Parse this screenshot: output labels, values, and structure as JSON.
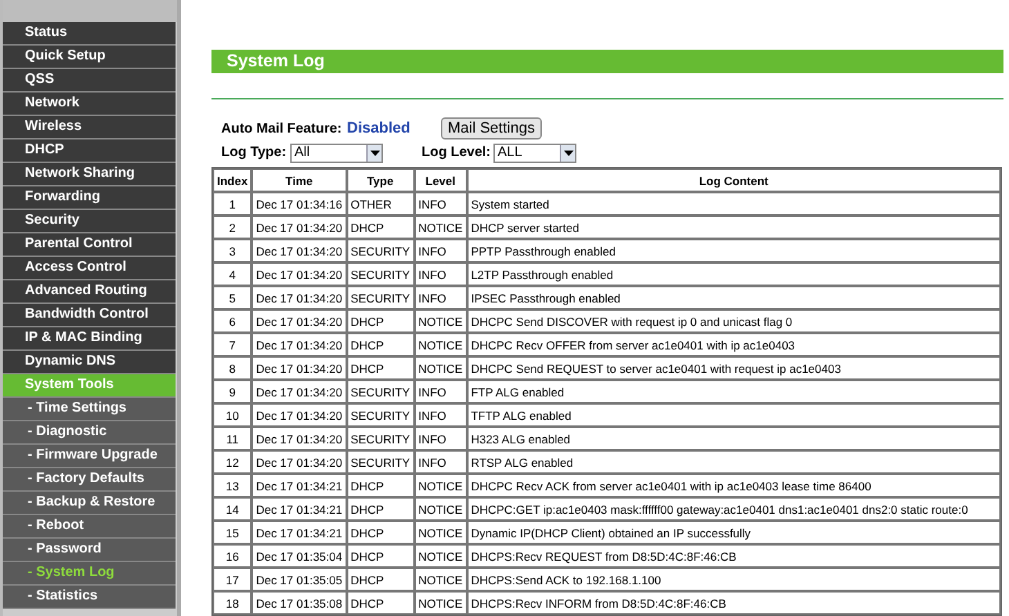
{
  "sidebar": {
    "items": [
      {
        "label": "Status",
        "kind": "section",
        "selected": false
      },
      {
        "label": "Quick Setup",
        "kind": "section",
        "selected": false
      },
      {
        "label": "QSS",
        "kind": "section",
        "selected": false
      },
      {
        "label": "Network",
        "kind": "section",
        "selected": false
      },
      {
        "label": "Wireless",
        "kind": "section",
        "selected": false
      },
      {
        "label": "DHCP",
        "kind": "section",
        "selected": false
      },
      {
        "label": "Network Sharing",
        "kind": "section",
        "selected": false
      },
      {
        "label": "Forwarding",
        "kind": "section",
        "selected": false
      },
      {
        "label": "Security",
        "kind": "section",
        "selected": false
      },
      {
        "label": "Parental Control",
        "kind": "section",
        "selected": false
      },
      {
        "label": "Access Control",
        "kind": "section",
        "selected": false
      },
      {
        "label": "Advanced Routing",
        "kind": "section",
        "selected": false
      },
      {
        "label": "Bandwidth Control",
        "kind": "section",
        "selected": false
      },
      {
        "label": "IP & MAC Binding",
        "kind": "section",
        "selected": false
      },
      {
        "label": "Dynamic DNS",
        "kind": "section",
        "selected": false
      },
      {
        "label": "System Tools",
        "kind": "section",
        "selected": true
      },
      {
        "label": "- Time Settings",
        "kind": "sub",
        "selected": false
      },
      {
        "label": "- Diagnostic",
        "kind": "sub",
        "selected": false
      },
      {
        "label": "- Firmware Upgrade",
        "kind": "sub",
        "selected": false
      },
      {
        "label": "- Factory Defaults",
        "kind": "sub",
        "selected": false
      },
      {
        "label": "- Backup & Restore",
        "kind": "sub",
        "selected": false
      },
      {
        "label": "- Reboot",
        "kind": "sub",
        "selected": false
      },
      {
        "label": "- Password",
        "kind": "sub",
        "selected": false
      },
      {
        "label": "- System Log",
        "kind": "sub",
        "selected": true
      },
      {
        "label": "- Statistics",
        "kind": "sub",
        "selected": false
      }
    ]
  },
  "page_title": "System Log",
  "auto_mail": {
    "label": "Auto Mail Feature:",
    "value": "Disabled",
    "button": "Mail Settings"
  },
  "filters": [
    {
      "label": "Log Type:",
      "value": "All"
    },
    {
      "label": "Log Level:",
      "value": "ALL"
    }
  ],
  "table": {
    "columns": [
      "Index",
      "Time",
      "Type",
      "Level",
      "Log Content"
    ],
    "rows": [
      [
        "1",
        "Dec 17 01:34:16",
        "OTHER",
        "INFO",
        "System started"
      ],
      [
        "2",
        "Dec 17 01:34:20",
        "DHCP",
        "NOTICE",
        "DHCP server started"
      ],
      [
        "3",
        "Dec 17 01:34:20",
        "SECURITY",
        "INFO",
        "PPTP Passthrough enabled"
      ],
      [
        "4",
        "Dec 17 01:34:20",
        "SECURITY",
        "INFO",
        "L2TP Passthrough enabled"
      ],
      [
        "5",
        "Dec 17 01:34:20",
        "SECURITY",
        "INFO",
        "IPSEC Passthrough enabled"
      ],
      [
        "6",
        "Dec 17 01:34:20",
        "DHCP",
        "NOTICE",
        "DHCPC Send DISCOVER with request ip 0 and unicast flag 0"
      ],
      [
        "7",
        "Dec 17 01:34:20",
        "DHCP",
        "NOTICE",
        "DHCPC Recv OFFER from server ac1e0401 with ip ac1e0403"
      ],
      [
        "8",
        "Dec 17 01:34:20",
        "DHCP",
        "NOTICE",
        "DHCPC Send REQUEST to server ac1e0401 with request ip ac1e0403"
      ],
      [
        "9",
        "Dec 17 01:34:20",
        "SECURITY",
        "INFO",
        "FTP ALG enabled"
      ],
      [
        "10",
        "Dec 17 01:34:20",
        "SECURITY",
        "INFO",
        "TFTP ALG enabled"
      ],
      [
        "11",
        "Dec 17 01:34:20",
        "SECURITY",
        "INFO",
        "H323 ALG enabled"
      ],
      [
        "12",
        "Dec 17 01:34:20",
        "SECURITY",
        "INFO",
        "RTSP ALG enabled"
      ],
      [
        "13",
        "Dec 17 01:34:21",
        "DHCP",
        "NOTICE",
        "DHCPC Recv ACK from server ac1e0401 with ip ac1e0403 lease time 86400"
      ],
      [
        "14",
        "Dec 17 01:34:21",
        "DHCP",
        "NOTICE",
        "DHCPC:GET ip:ac1e0403 mask:ffffff00 gateway:ac1e0401 dns1:ac1e0401 dns2:0 static route:0"
      ],
      [
        "15",
        "Dec 17 01:34:21",
        "DHCP",
        "NOTICE",
        "Dynamic IP(DHCP Client) obtained an IP successfully"
      ],
      [
        "16",
        "Dec 17 01:35:04",
        "DHCP",
        "NOTICE",
        "DHCPS:Recv REQUEST from D8:5D:4C:8F:46:CB"
      ],
      [
        "17",
        "Dec 17 01:35:05",
        "DHCP",
        "NOTICE",
        "DHCPS:Send ACK to 192.168.1.100"
      ],
      [
        "18",
        "Dec 17 01:35:08",
        "DHCP",
        "NOTICE",
        "DHCPS:Recv INFORM from D8:5D:4C:8F:46:CB"
      ]
    ]
  }
}
